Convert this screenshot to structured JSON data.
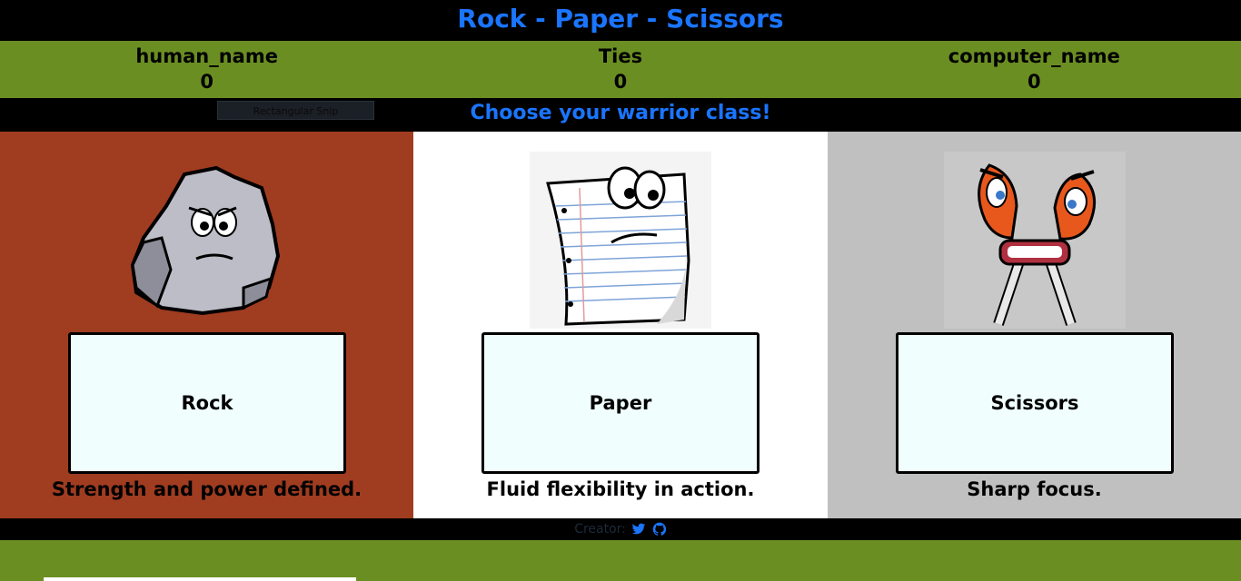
{
  "header": {
    "title": "Rock - Paper - Scissors"
  },
  "score": {
    "human_label": "human_name",
    "human_score": "0",
    "ties_label": "Ties",
    "ties_score": "0",
    "computer_label": "computer_name",
    "computer_score": "0"
  },
  "prompt": "Choose your warrior class!",
  "snip_tooltip": "Rectangular Snip",
  "choices": [
    {
      "label": "Rock",
      "description": "Strength and power defined.",
      "panel_color": "#a03c20"
    },
    {
      "label": "Paper",
      "description": "Fluid flexibility in action.",
      "panel_color": "#ffffff"
    },
    {
      "label": "Scissors",
      "description": "Sharp focus.",
      "panel_color": "#c0c0c0"
    }
  ],
  "footer": {
    "text": "Creator:",
    "icons": [
      "twitter-icon",
      "github-icon"
    ]
  },
  "colors": {
    "accent": "#1a75ff",
    "bar": "#6b8e23",
    "dark": "#000000"
  }
}
